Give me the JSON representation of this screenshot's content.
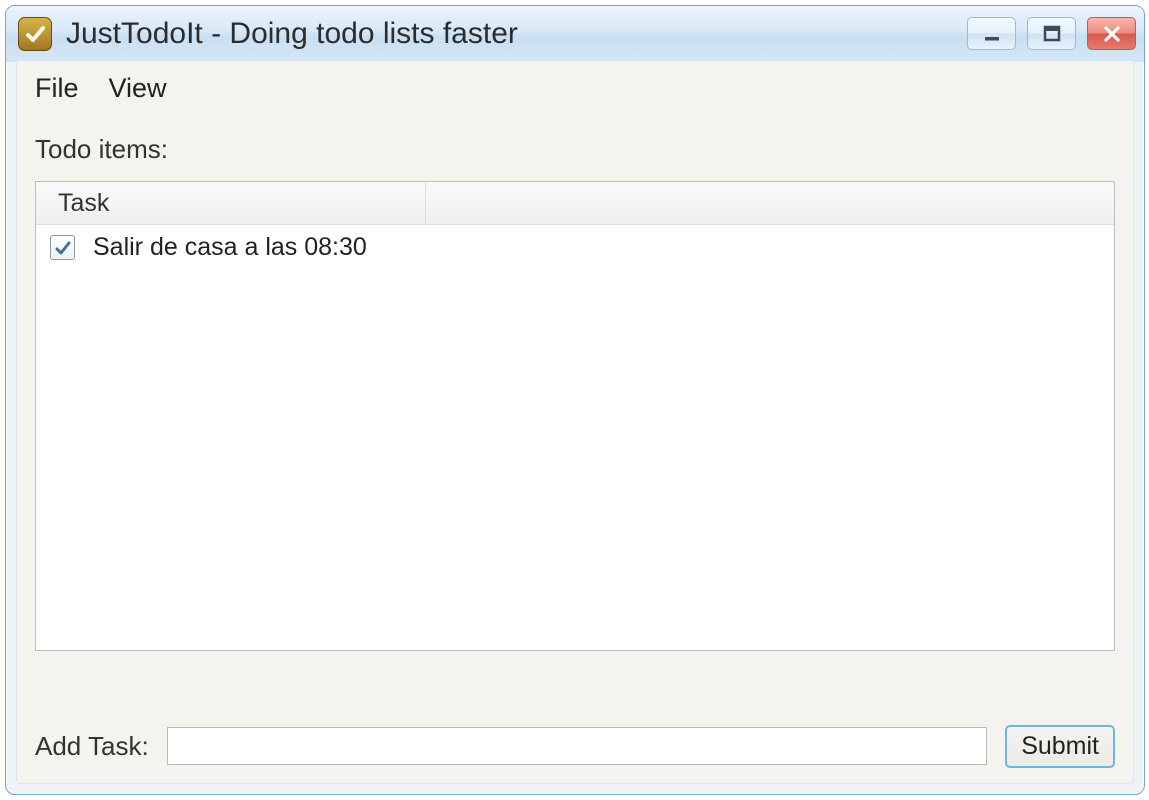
{
  "window": {
    "title": "JustTodoIt - Doing todo lists faster"
  },
  "menubar": {
    "file": "File",
    "view": "View"
  },
  "labels": {
    "todo_items": "Todo items:",
    "add_task": "Add Task:"
  },
  "list": {
    "header_task": "Task",
    "rows": [
      {
        "checked": true,
        "text": "Salir de casa a las 08:30"
      }
    ]
  },
  "input": {
    "value": ""
  },
  "buttons": {
    "submit": "Submit"
  }
}
